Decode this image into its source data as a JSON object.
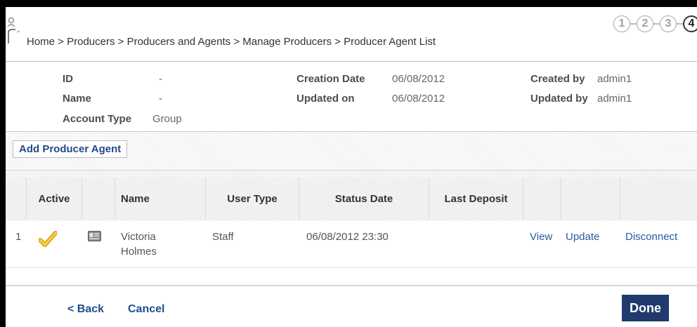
{
  "header": {
    "breadcrumb": "Home > Producers > Producers and Agents > Manage Producers > Producer Agent List",
    "steps": [
      "1",
      "2",
      "3",
      "4"
    ]
  },
  "info": {
    "id_label": "ID",
    "id_value": "-",
    "name_label": "Name",
    "name_value": "-",
    "account_type_label": "Account Type",
    "account_type_value": "Group",
    "creation_date_label": "Creation Date",
    "creation_date_value": "06/08/2012",
    "updated_on_label": "Updated on",
    "updated_on_value": "06/08/2012",
    "created_by_label": "Created by",
    "created_by_value": "admin1",
    "updated_by_label": "Updated by",
    "updated_by_value": "admin1"
  },
  "toolbar": {
    "add_label": "Add Producer Agent"
  },
  "table": {
    "columns": [
      "Active",
      "Name",
      "User Type",
      "Status Date",
      "Last Deposit"
    ],
    "rows": [
      {
        "index": "1",
        "active": true,
        "name_line1": "Victoria",
        "name_line2": "Holmes",
        "user_type": "Staff",
        "status_date": "06/08/2012 23:30",
        "last_deposit": "",
        "view": "View",
        "update": "Update",
        "disconnect": "Disconnect"
      }
    ]
  },
  "footer": {
    "back_label": "< Back",
    "cancel_label": "Cancel",
    "done_label": "Done"
  },
  "colors": {
    "done_button": "#203a6e",
    "link": "#2a5a9e",
    "check": "#f0c419"
  }
}
